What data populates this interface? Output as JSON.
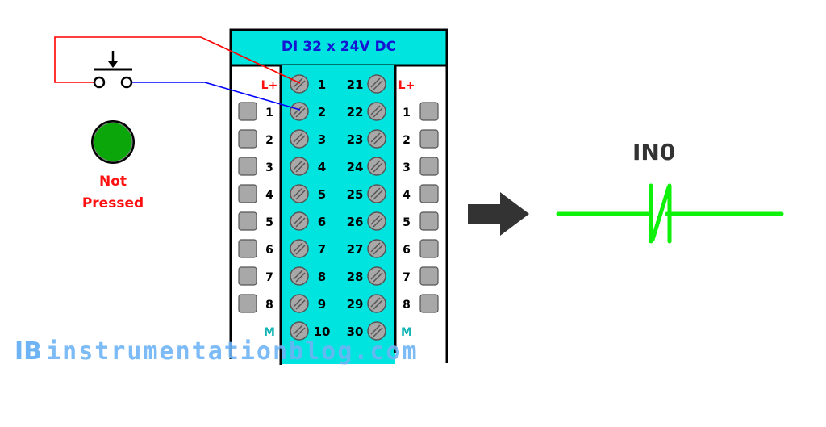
{
  "module": {
    "title": "DI 32 x 24V DC",
    "left_terminals": [
      "1",
      "2",
      "3",
      "4",
      "5",
      "6",
      "7",
      "8",
      "9",
      "10"
    ],
    "right_terminals": [
      "21",
      "22",
      "23",
      "24",
      "25",
      "26",
      "27",
      "28",
      "29",
      "30"
    ],
    "left_channels": [
      "L+",
      "1",
      "2",
      "3",
      "4",
      "5",
      "6",
      "7",
      "8",
      "M"
    ],
    "right_channels": [
      "L+",
      "1",
      "2",
      "3",
      "4",
      "5",
      "6",
      "7",
      "8",
      "M"
    ]
  },
  "switch": {
    "status_line1": "Not",
    "status_line2": "Pressed",
    "indicator_color": "#0aa60a"
  },
  "ladder": {
    "label": "IN0",
    "contact_type": "normally-closed",
    "contact_color": "#0ff00a"
  },
  "colors": {
    "module_bg": "#00e4e0",
    "title_color": "#1414d2",
    "lplus_color": "#ff1010",
    "m_color": "#10b4b4",
    "wire_red": "#ff0000",
    "wire_blue": "#0000ff",
    "arrow": "#333333"
  },
  "watermark": {
    "text": "instrumentationblog.com",
    "logo": "IB"
  }
}
